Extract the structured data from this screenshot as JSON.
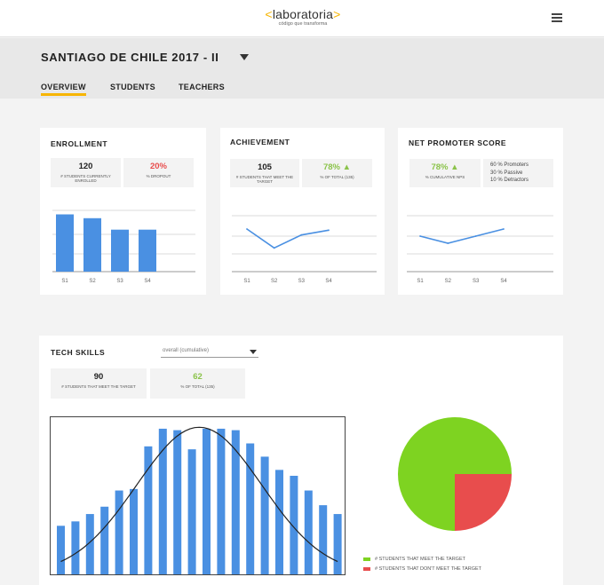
{
  "brand": {
    "word": "laboratoria",
    "tagline": "código que transforma",
    "accent": "#f7b500"
  },
  "header": {
    "cohort": "SANTIAGO DE CHILE 2017 - II"
  },
  "tabs": [
    {
      "label": "OVERVIEW",
      "active": true
    },
    {
      "label": "STUDENTS",
      "active": false
    },
    {
      "label": "TEACHERS",
      "active": false
    }
  ],
  "enrollment": {
    "title": "ENROLLMENT",
    "stat1": {
      "value": "120",
      "label": "# STUDENTS CURRENTLY ENROLLED"
    },
    "stat2": {
      "value": "20%",
      "label": "% DROPOUT"
    },
    "chart_data": {
      "type": "bar",
      "categories": [
        "S1",
        "S2",
        "S3",
        "S4"
      ],
      "values": [
        4.5,
        4.2,
        3.3,
        3.3
      ],
      "ylim": [
        0,
        6
      ],
      "color": "#4a90e2",
      "grid": true
    }
  },
  "achievement": {
    "title": "ACHIEVEMENT",
    "stat1": {
      "value": "105",
      "label": "# STUDENTS THAT MEET THE TARGET"
    },
    "stat2": {
      "value": "78% ▲",
      "label": "% OF TOTAL (135)"
    },
    "chart_data": {
      "type": "line",
      "categories": [
        "S1",
        "S2",
        "S3",
        "S4"
      ],
      "values": [
        3.6,
        2.0,
        3.1,
        3.5
      ],
      "ylim": [
        0,
        6
      ],
      "color": "#4a90e2",
      "grid": true
    }
  },
  "nps": {
    "title": "NET PROMOTER SCORE",
    "stat1": {
      "value": "78% ▲",
      "label": "% CUMULATIVE NPS"
    },
    "breakdown": [
      "60 %  Promoters",
      "30 %  Passive",
      "10 %  Detractors"
    ],
    "chart_data": {
      "type": "line",
      "categories": [
        "S1",
        "S2",
        "S3",
        "S4"
      ],
      "values": [
        3.0,
        2.4,
        3.0,
        3.6
      ],
      "ylim": [
        0,
        6
      ],
      "color": "#4a90e2",
      "grid": true
    }
  },
  "tech": {
    "title": "TECH SKILLS",
    "select_value": "overall (cumulative)",
    "stat1": {
      "value": "90",
      "label": "# STUDENTS THAT MEET THE TARGET"
    },
    "stat2": {
      "value": "62",
      "label": "% OF TOTAL (135)"
    },
    "histogram": {
      "chart_data": {
        "type": "bar",
        "values": [
          3.3,
          3.6,
          4.1,
          4.6,
          5.7,
          5.8,
          8.7,
          9.9,
          9.8,
          8.5,
          9.9,
          9.9,
          9.8,
          8.9,
          8.0,
          7.1,
          6.7,
          5.7,
          4.7,
          4.1
        ],
        "ylim": [
          0,
          10.5
        ],
        "color": "#4a90e2",
        "curve": "normal"
      }
    },
    "pie": {
      "chart_data": {
        "type": "pie",
        "values": [
          75,
          25
        ],
        "colors": [
          "#7ed321",
          "#e84d4d"
        ]
      },
      "legend": [
        "# STUDENTS THAT MEET THE TARGET",
        "# STUDENTS THAT DON'T MEET THE TARGET"
      ]
    }
  }
}
